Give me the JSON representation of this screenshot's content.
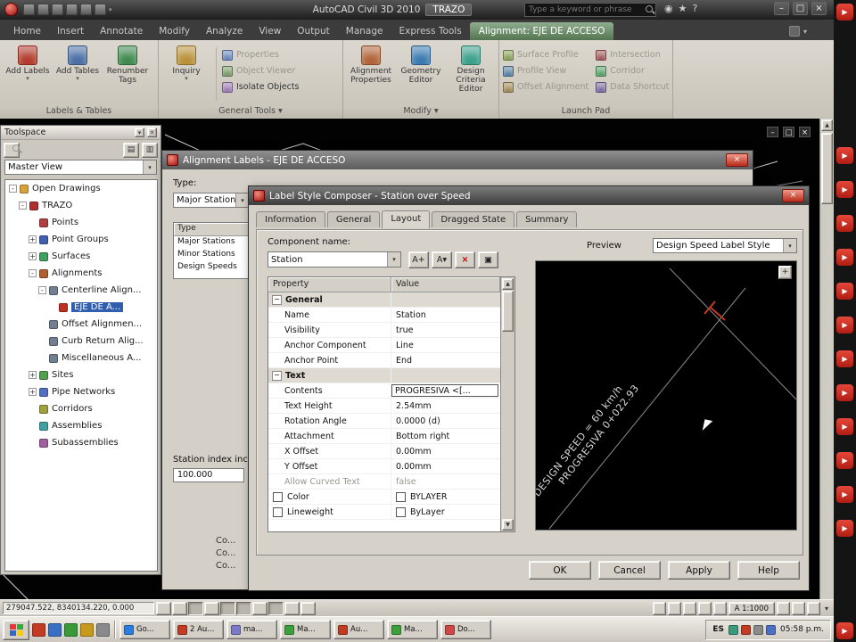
{
  "titlebar": {
    "app_title": "AutoCAD Civil 3D 2010",
    "doc_name": "TRAZO",
    "search_placeholder": "Type a keyword or phrase",
    "window_buttons": [
      "–",
      "□",
      "×"
    ]
  },
  "ribbon": {
    "tabs": [
      {
        "label": "Home"
      },
      {
        "label": "Insert"
      },
      {
        "label": "Annotate"
      },
      {
        "label": "Modify"
      },
      {
        "label": "Analyze"
      },
      {
        "label": "View"
      },
      {
        "label": "Output"
      },
      {
        "label": "Manage"
      },
      {
        "label": "Express Tools"
      }
    ],
    "context_tab": "Alignment: EJE DE ACCESO",
    "panels": {
      "labels_tables": {
        "label": "Labels & Tables",
        "buttons": [
          {
            "label": "Add Labels",
            "caret": "▾",
            "ic": "#b23b2e"
          },
          {
            "label": "Add Tables",
            "caret": "▾",
            "ic": "#4a6fa5"
          },
          {
            "label": "Renumber Tags",
            "ic": "#3f8a4f"
          }
        ]
      },
      "general_tools": {
        "label": "General Tools ▾",
        "big": {
          "label": "Inquiry",
          "caret": "▾",
          "ic": "#b8913a"
        },
        "items": [
          {
            "label": "Properties",
            "ic": "#6a86b8",
            "cls": "dim"
          },
          {
            "label": "Object Viewer",
            "ic": "#7a9a6a",
            "cls": "dim"
          },
          {
            "label": "Isolate Objects",
            "ic": "#9a7ab0"
          }
        ]
      },
      "modify": {
        "label": "Modify ▾",
        "buttons": [
          {
            "label": "Alignment Properties",
            "ic": "#b0643a"
          },
          {
            "label": "Geometry Editor",
            "ic": "#3a7ab0"
          },
          {
            "label": "Design Criteria Editor",
            "ic": "#3aa08a"
          }
        ]
      },
      "launch_pad": {
        "label": "Launch Pad",
        "col1": [
          {
            "label": "Surface Profile",
            "ic": "#8aa05a",
            "cls": "dim"
          },
          {
            "label": "Profile View",
            "ic": "#5a80a0",
            "cls": "dim"
          },
          {
            "label": "Offset Alignment",
            "ic": "#a08a5a",
            "cls": "dim"
          }
        ],
        "col2": [
          {
            "label": "Intersection",
            "ic": "#a05a5a",
            "cls": "dim"
          },
          {
            "label": "Corridor",
            "ic": "#5aa06a",
            "cls": "dim"
          },
          {
            "label": "Data Shortcut",
            "ic": "#7a6aa0",
            "cls": "dim"
          }
        ]
      }
    }
  },
  "toolspace": {
    "title": "Toolspace",
    "view_selector": "Master View",
    "tree": [
      {
        "label": "Open Drawings",
        "level": 0,
        "exp": "-",
        "icon": "open-drawings-folder-icon",
        "ic": "#d9a33c"
      },
      {
        "label": "TRAZO",
        "level": 1,
        "exp": "-",
        "icon": "drawing-icon",
        "ic": "#b03030"
      },
      {
        "label": "Points",
        "level": 2,
        "exp": "",
        "icon": "points-icon",
        "ic": "#b04040"
      },
      {
        "label": "Point Groups",
        "level": 2,
        "exp": "+",
        "icon": "point-groups-icon",
        "ic": "#4060b0"
      },
      {
        "label": "Surfaces",
        "level": 2,
        "exp": "+",
        "icon": "surfaces-icon",
        "ic": "#40a060"
      },
      {
        "label": "Alignments",
        "level": 2,
        "exp": "-",
        "icon": "alignments-icon",
        "ic": "#b06030"
      },
      {
        "label": "Centerline Align...",
        "level": 3,
        "exp": "-",
        "icon": "centerline-alignments-icon",
        "ic": "#708090"
      },
      {
        "label": "EJE DE A...",
        "level": 4,
        "exp": "",
        "icon": "alignment-icon",
        "ic": "#c03020",
        "cls": "sel"
      },
      {
        "label": "Offset Alignmen...",
        "level": 3,
        "exp": "",
        "icon": "offset-alignments-icon",
        "ic": "#708090"
      },
      {
        "label": "Curb Return Alig...",
        "level": 3,
        "exp": "",
        "icon": "curb-return-alignments-icon",
        "ic": "#708090"
      },
      {
        "label": "Miscellaneous A...",
        "level": 3,
        "exp": "",
        "icon": "miscellaneous-alignments-icon",
        "ic": "#708090"
      },
      {
        "label": "Sites",
        "level": 2,
        "exp": "+",
        "icon": "sites-icon",
        "ic": "#50a050"
      },
      {
        "label": "Pipe Networks",
        "level": 2,
        "exp": "+",
        "icon": "pipe-networks-icon",
        "ic": "#5070c0"
      },
      {
        "label": "Corridors",
        "level": 2,
        "exp": "",
        "icon": "corridors-icon",
        "ic": "#a0a040"
      },
      {
        "label": "Assemblies",
        "level": 2,
        "exp": "",
        "icon": "assemblies-icon",
        "ic": "#40a0a0"
      },
      {
        "label": "Subassemblies",
        "level": 2,
        "exp": "",
        "icon": "subassemblies-icon",
        "ic": "#a060a0"
      }
    ]
  },
  "canvas": {
    "window_buttons": [
      "–",
      "□",
      "×"
    ]
  },
  "alignment_labels_dialog": {
    "title": "Alignment Labels - EJE DE ACCESO",
    "type_label": "Type:",
    "type_value": "Major Stations",
    "list_header": "Type",
    "list_rows": [
      {
        "label": "Major Stations"
      },
      {
        "label": "Minor Stations"
      },
      {
        "label": "Design Speeds"
      }
    ],
    "station_index_label": "Station index incr...",
    "station_index_value": "100.000",
    "truncated_lines": [
      {
        "label": "Co..."
      },
      {
        "label": "Co..."
      },
      {
        "label": "Co..."
      }
    ]
  },
  "label_style_composer": {
    "title": "Label Style Composer - Station over Speed",
    "tabs": [
      {
        "label": "Information"
      },
      {
        "label": "General"
      },
      {
        "label": "Layout",
        "cls": "active"
      },
      {
        "label": "Dragged State"
      },
      {
        "label": "Summary"
      }
    ],
    "component_name_label": "Component name:",
    "component_name_value": "Station",
    "component_toolbar": [
      {
        "glyph": "A+",
        "icon": "create-text-component-icon"
      },
      {
        "glyph": "A▾",
        "icon": "copy-component-icon"
      },
      {
        "glyph": "×",
        "icon": "delete-component-icon",
        "cls": "red"
      },
      {
        "glyph": "▣",
        "icon": "component-draworder-icon"
      }
    ],
    "grid": {
      "columns": {
        "property": "Property",
        "value": "Value"
      },
      "rows": [
        {
          "cls": "group",
          "property": "General",
          "value": ""
        },
        {
          "property": "Name",
          "value": "Station"
        },
        {
          "property": "Visibility",
          "value": "true"
        },
        {
          "property": "Anchor Component",
          "value": "Line"
        },
        {
          "property": "Anchor Point",
          "value": "End"
        },
        {
          "cls": "group",
          "property": "Text",
          "value": ""
        },
        {
          "cls": "editing",
          "property": "Contents",
          "value": "PROGRESIVA <[..."
        },
        {
          "property": "Text Height",
          "value": "2.54mm"
        },
        {
          "property": "Rotation Angle",
          "value": "0.0000 (d)"
        },
        {
          "property": "Attachment",
          "value": "Bottom right"
        },
        {
          "property": "X Offset",
          "value": "0.00mm"
        },
        {
          "property": "Y Offset",
          "value": "0.00mm"
        },
        {
          "cls": "dim",
          "property": "Allow Curved Text",
          "value": "false"
        },
        {
          "cls": "chk",
          "property": "Color",
          "value": "BYLAYER"
        },
        {
          "cls": "chk",
          "property": "Lineweight",
          "value": "ByLayer"
        }
      ]
    },
    "preview_label": "Preview",
    "preview_style": "Design Speed Label Style",
    "preview_texts": {
      "line1": "DESIGN SPEED = 60 km/h",
      "line2": "PROGRESIVA 0+022.93"
    },
    "buttons": [
      {
        "label": "OK"
      },
      {
        "label": "Cancel"
      },
      {
        "label": "Apply"
      },
      {
        "label": "Help"
      }
    ]
  },
  "statusbar": {
    "coords": "279047.522, 8340134.220, 0.000",
    "toggles": [
      {
        "name": "snap-toggle"
      },
      {
        "name": "grid-toggle"
      },
      {
        "name": "ortho-toggle",
        "cls": "on"
      },
      {
        "name": "polar-toggle"
      },
      {
        "name": "osnap-toggle",
        "cls": "on"
      },
      {
        "name": "otrack-toggle",
        "cls": "on"
      },
      {
        "name": "ducs-toggle"
      },
      {
        "name": "dyn-toggle",
        "cls": "on"
      },
      {
        "name": "lwt-toggle"
      },
      {
        "name": "qp-toggle"
      }
    ],
    "scale": "A 1:1000"
  },
  "taskbar": {
    "quick_launch": [
      {
        "ic": "#c23b22"
      },
      {
        "ic": "#3a6fc4"
      },
      {
        "ic": "#3a9a3a"
      },
      {
        "ic": "#c79a1e"
      },
      {
        "ic": "#8a8a8a"
      }
    ],
    "buttons": [
      {
        "label": "Go...",
        "ic": "#2a7de1"
      },
      {
        "label": "2 Au...",
        "ic": "#c23b22"
      },
      {
        "label": "ma...",
        "ic": "#7a7ac8"
      },
      {
        "label": "Ma...",
        "ic": "#3aa03a"
      },
      {
        "label": "Au...",
        "ic": "#c23b22"
      },
      {
        "label": "Ma...",
        "ic": "#3aa03a"
      },
      {
        "label": "Do...",
        "ic": "#d04545"
      }
    ],
    "lang": "ES",
    "tray_icons": [
      {
        "ic": "#3a9a7a"
      },
      {
        "ic": "#c23b22"
      },
      {
        "ic": "#8a8a8a"
      },
      {
        "ic": "#4a6fc4"
      }
    ],
    "time": "05:58 p.m."
  },
  "video_strip": {
    "top": "▶",
    "icons": [
      "▶",
      "▶",
      "▶",
      "▶",
      "▶",
      "▶",
      "▶",
      "▶",
      "▶",
      "▶",
      "▶",
      "▶"
    ],
    "bottom": "▶"
  },
  "colors": {
    "context_tab_green": "#5d7f5d",
    "selection_blue": "#2f5fae",
    "accent_red": "#cf2a27"
  }
}
